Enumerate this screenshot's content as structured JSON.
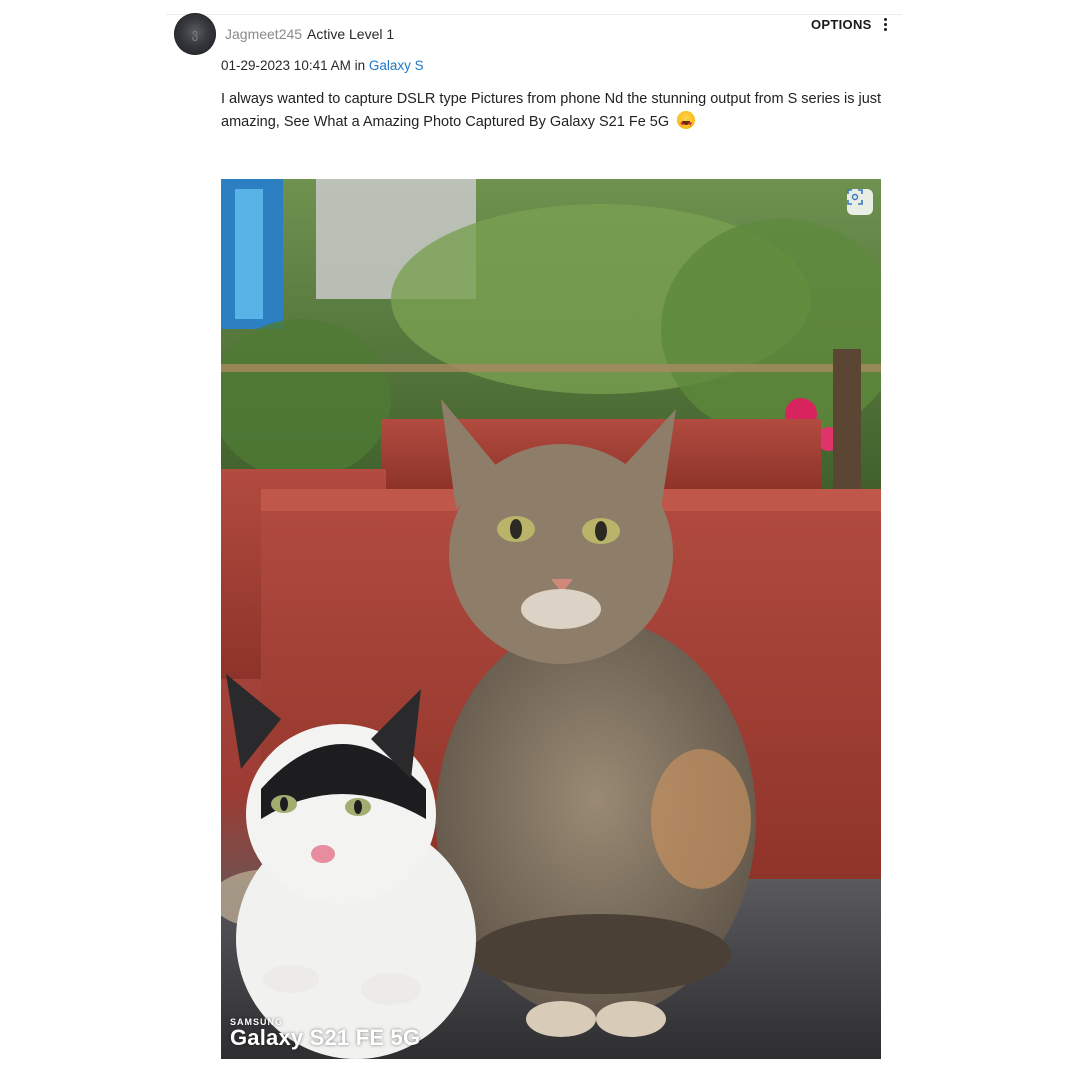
{
  "post": {
    "author": {
      "username": "Jagmeet245",
      "rank": "Active Level 1"
    },
    "options_label": "OPTIONS",
    "timestamp": "01-29-2023 10:41 AM",
    "in_word": "in",
    "board": "Galaxy S",
    "body": "I always wanted to capture DSLR type Pictures from phone Nd the stunning output from S series is just amazing, See What a Amazing Photo Captured By Galaxy S21 Fe 5G",
    "emoji": "smiling-face-with-heart-eyes-icon",
    "image": {
      "watermark_brand": "SAMSUNG",
      "watermark_model": "Galaxy S21 FE 5G",
      "scan_icon": "image-scan-icon"
    }
  },
  "colors": {
    "link": "#1f78c8",
    "text": "#222222",
    "muted": "#8a8a8a"
  }
}
